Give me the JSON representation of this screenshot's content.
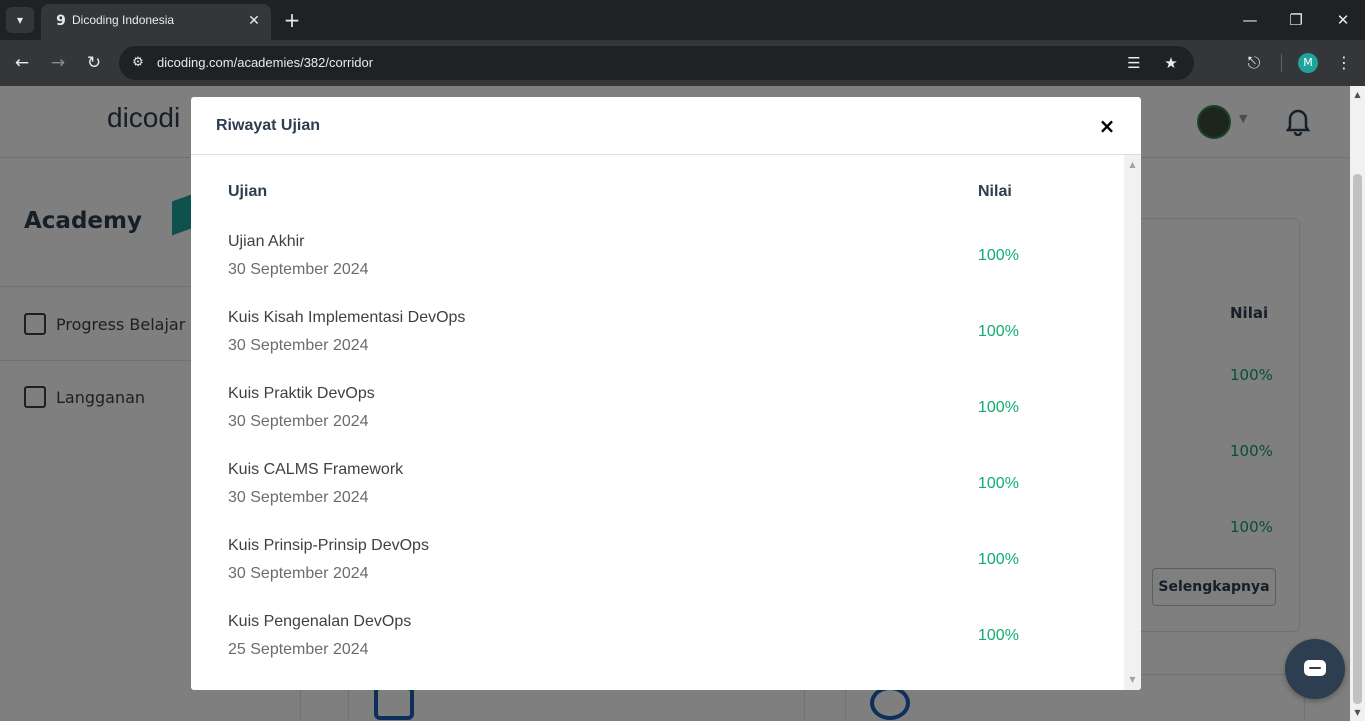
{
  "browser": {
    "tab_title": "Dicoding Indonesia",
    "url": "dicoding.com/academies/382/corridor",
    "profile_initial": "M"
  },
  "page": {
    "logo": "dicodi",
    "sidebar_title": "Academy",
    "sidebar_items": [
      {
        "label": "Progress Belajar",
        "icon": "progress-icon"
      },
      {
        "label": "Langganan",
        "icon": "document-icon"
      }
    ],
    "background_card": {
      "column_header": "Nilai",
      "scores": [
        "100%",
        "100%",
        "100%"
      ],
      "button_label": "Selengkapnya"
    }
  },
  "modal": {
    "title": "Riwayat Ujian",
    "close_symbol": "×",
    "headers": {
      "exam": "Ujian",
      "score": "Nilai"
    },
    "rows": [
      {
        "name": "Ujian Akhir",
        "date": "30 September 2024",
        "score": "100%"
      },
      {
        "name": "Kuis Kisah Implementasi DevOps",
        "date": "30 September 2024",
        "score": "100%"
      },
      {
        "name": "Kuis Praktik DevOps",
        "date": "30 September 2024",
        "score": "100%"
      },
      {
        "name": "Kuis CALMS Framework",
        "date": "30 September 2024",
        "score": "100%"
      },
      {
        "name": "Kuis Prinsip-Prinsip DevOps",
        "date": "30 September 2024",
        "score": "100%"
      },
      {
        "name": "Kuis Pengenalan DevOps",
        "date": "25 September 2024",
        "score": "100%"
      }
    ]
  },
  "colors": {
    "score_green": "#0fae6f",
    "brand_navy": "#2d3e50",
    "brand_teal": "#1fa39b"
  }
}
